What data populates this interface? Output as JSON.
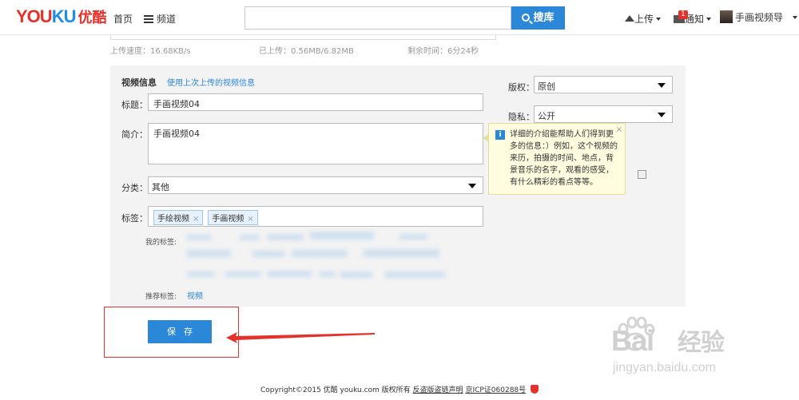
{
  "header": {
    "logo_text": "YOUKU",
    "logo_cn": "优酷",
    "nav_home": "首页",
    "nav_channel": "频道",
    "search_value": "",
    "search_button": "搜库",
    "upload_label": "上传",
    "notice_label": "通知",
    "notice_count": "1",
    "user_name": "手画视频导"
  },
  "upload_status": {
    "speed": "上传速度：16.68KB/s",
    "uploaded": "已上传：0.56MB/6.82MB",
    "remaining": "剩余时间：6分24秒"
  },
  "form": {
    "section_title": "视频信息",
    "reuse_link": "使用上次上传的视频信息",
    "title_label": "标题：",
    "title_value": "手画视频04",
    "desc_label": "简介：",
    "desc_value": "手画视频04",
    "category_label": "分类：",
    "category_value": "其他",
    "tags_label": "标签：",
    "tags": [
      "手绘视频",
      "手画视频"
    ],
    "my_tags_label": "我的标签:",
    "recommended_label": "推荐标签:",
    "recommended_link": "视频",
    "copyright_label": "版权：",
    "copyright_value": "原创",
    "privacy_label": "隐私：",
    "privacy_value": "公开"
  },
  "tooltip": {
    "text": "详细的介绍能帮助人们得到更多的信息：）例如，这个视频的来历，拍摄的时间、地点，背景音乐的名字，观看的感受，有什么精彩的看点等等。",
    "close": "×"
  },
  "save_button": "保存",
  "footer": {
    "copyright": "Copyright©2015 优酷 youku.com 版权所有",
    "anti_piracy": "反盗版盗链声明",
    "icp": "京ICP证060288号"
  },
  "watermark": {
    "brand": "Bai",
    "brand_cn": "经验",
    "url": "jingyan.baidu.com"
  },
  "colors": {
    "accent_blue": "#2b87d8",
    "brand_red": "#e4322b",
    "tooltip_bg": "#fffce0",
    "panel_bg": "#f3f3f3"
  }
}
